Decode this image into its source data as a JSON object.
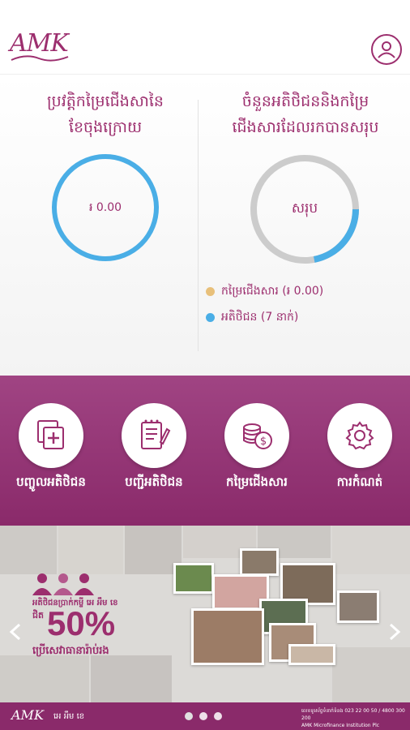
{
  "header": {
    "logo_text": "AMK",
    "profile_icon": "user-icon"
  },
  "stats": {
    "left": {
      "title_line1": "ប្រវត្តិកម្រៃជើងសានៃ",
      "title_line2": "ខែចុងក្រោយ",
      "ring_value": "៛ 0.00",
      "ring_color": "#4aaee6"
    },
    "right": {
      "title_line1": "ចំនួនអតិថិជននិងកម្រៃ",
      "title_line2": "ជើងសារដែលរកបានសរុប",
      "ring_label": "សរុប",
      "ring_track_color": "#cccccc",
      "ring_progress_color": "#4aaee6",
      "ring_progress_fraction": 0.22
    },
    "legend": [
      {
        "label": "កម្រៃជើងសារ (៛ 0.00)",
        "color": "#e8c07a"
      },
      {
        "label": "អតិថិជន (7 នាក់)",
        "color": "#4aaee6"
      }
    ]
  },
  "menu": {
    "items": [
      {
        "label": "បញ្ចូលអតិថិជន",
        "icon": "add-customer-icon"
      },
      {
        "label": "បញ្ជីអតិថិជន",
        "icon": "customer-list-icon"
      },
      {
        "label": "កម្រៃជើងសារ",
        "icon": "commission-coins-icon"
      },
      {
        "label": "ការកំណត់",
        "icon": "gear-icon"
      }
    ]
  },
  "banner": {
    "promo_line1": "អតិថិជនប្រាក់កម្ចី អេ អឹម ខេ",
    "promo_line2": "ជិត",
    "promo_percent": "50%",
    "promo_line3": "ប្រើសេវាធានារ៉ាប់រង",
    "slides_total": 3,
    "slide_active": 1
  },
  "footer": {
    "logo_text": "AMK",
    "tagline": "អេ អឹម ខេ",
    "contact": "លេខទូរស័ព្ទទំនាក់ទំនង 023 22 00 50 / 4800 300 200",
    "web": "AMK Microfinance Institution Plc"
  },
  "colors": {
    "brand": "#9c2e6e",
    "menu_bg": "#8a2a6a",
    "ring_blue": "#4aaee6"
  }
}
